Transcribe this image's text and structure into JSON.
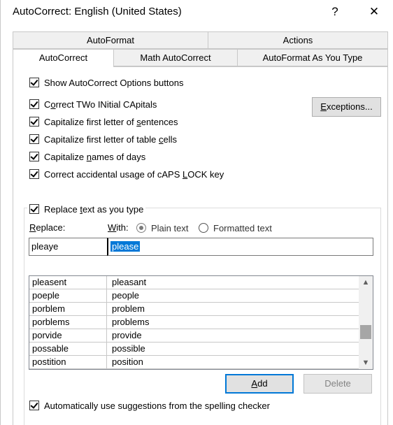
{
  "window": {
    "title": "AutoCorrect: English (United States)",
    "help_glyph": "?",
    "close_glyph": "✕"
  },
  "tabs": {
    "row_back": [
      {
        "label": "AutoFormat"
      },
      {
        "label": "Actions"
      }
    ],
    "row_front": [
      {
        "label": "AutoCorrect",
        "active": true
      },
      {
        "label": "Math AutoCorrect"
      },
      {
        "label": "AutoFormat As You Type"
      }
    ]
  },
  "options": {
    "show_buttons": {
      "label": "Show AutoCorrect Options buttons",
      "checked": true
    },
    "two_initial": {
      "label_pre": "C",
      "label_u": "o",
      "label_post": "rrect TWo INitial CApitals",
      "checked": true
    },
    "first_sentence": {
      "label_pre": "Capitalize first letter of ",
      "label_u": "s",
      "label_post": "entences",
      "checked": true
    },
    "table_cells": {
      "label_pre": "Capitalize first letter of table ",
      "label_u": "c",
      "label_post": "ells",
      "checked": true
    },
    "days": {
      "label_pre": "Capitalize ",
      "label_u": "n",
      "label_post": "ames of days",
      "checked": true
    },
    "caps_lock": {
      "label_pre": "Correct accidental usage of cAPS ",
      "label_u": "L",
      "label_post": "OCK key",
      "checked": true
    }
  },
  "exceptions_button": {
    "label_u": "E",
    "label_post": "xceptions..."
  },
  "replace_group": {
    "legend_pre": "Replace ",
    "legend_u": "t",
    "legend_post": "ext as you type",
    "checked": true,
    "replace_label_u": "R",
    "replace_label_post": "eplace:",
    "with_label_u": "W",
    "with_label_post": "ith:",
    "plain_text": {
      "label": "Plain text",
      "checked": true
    },
    "formatted_text": {
      "label": "Formatted text",
      "checked": false
    },
    "replace_value": "pleaye",
    "with_value": "please"
  },
  "entries": [
    {
      "from": "pleasent",
      "to": "pleasant"
    },
    {
      "from": "poeple",
      "to": "people"
    },
    {
      "from": "porblem",
      "to": "problem"
    },
    {
      "from": "porblems",
      "to": "problems"
    },
    {
      "from": "porvide",
      "to": "provide"
    },
    {
      "from": "possable",
      "to": "possible"
    },
    {
      "from": "postition",
      "to": "position"
    }
  ],
  "scroll_up_glyph": "▲",
  "scroll_down_glyph": "▼",
  "add_button": {
    "label_u": "A",
    "label_post": "dd"
  },
  "delete_button": {
    "label": "Delete"
  },
  "spell_suggestions": {
    "label": "Automatically use suggestions from the spelling checker",
    "checked": true
  },
  "colors": {
    "accent": "#0078d7",
    "selection": "#0078d7"
  }
}
